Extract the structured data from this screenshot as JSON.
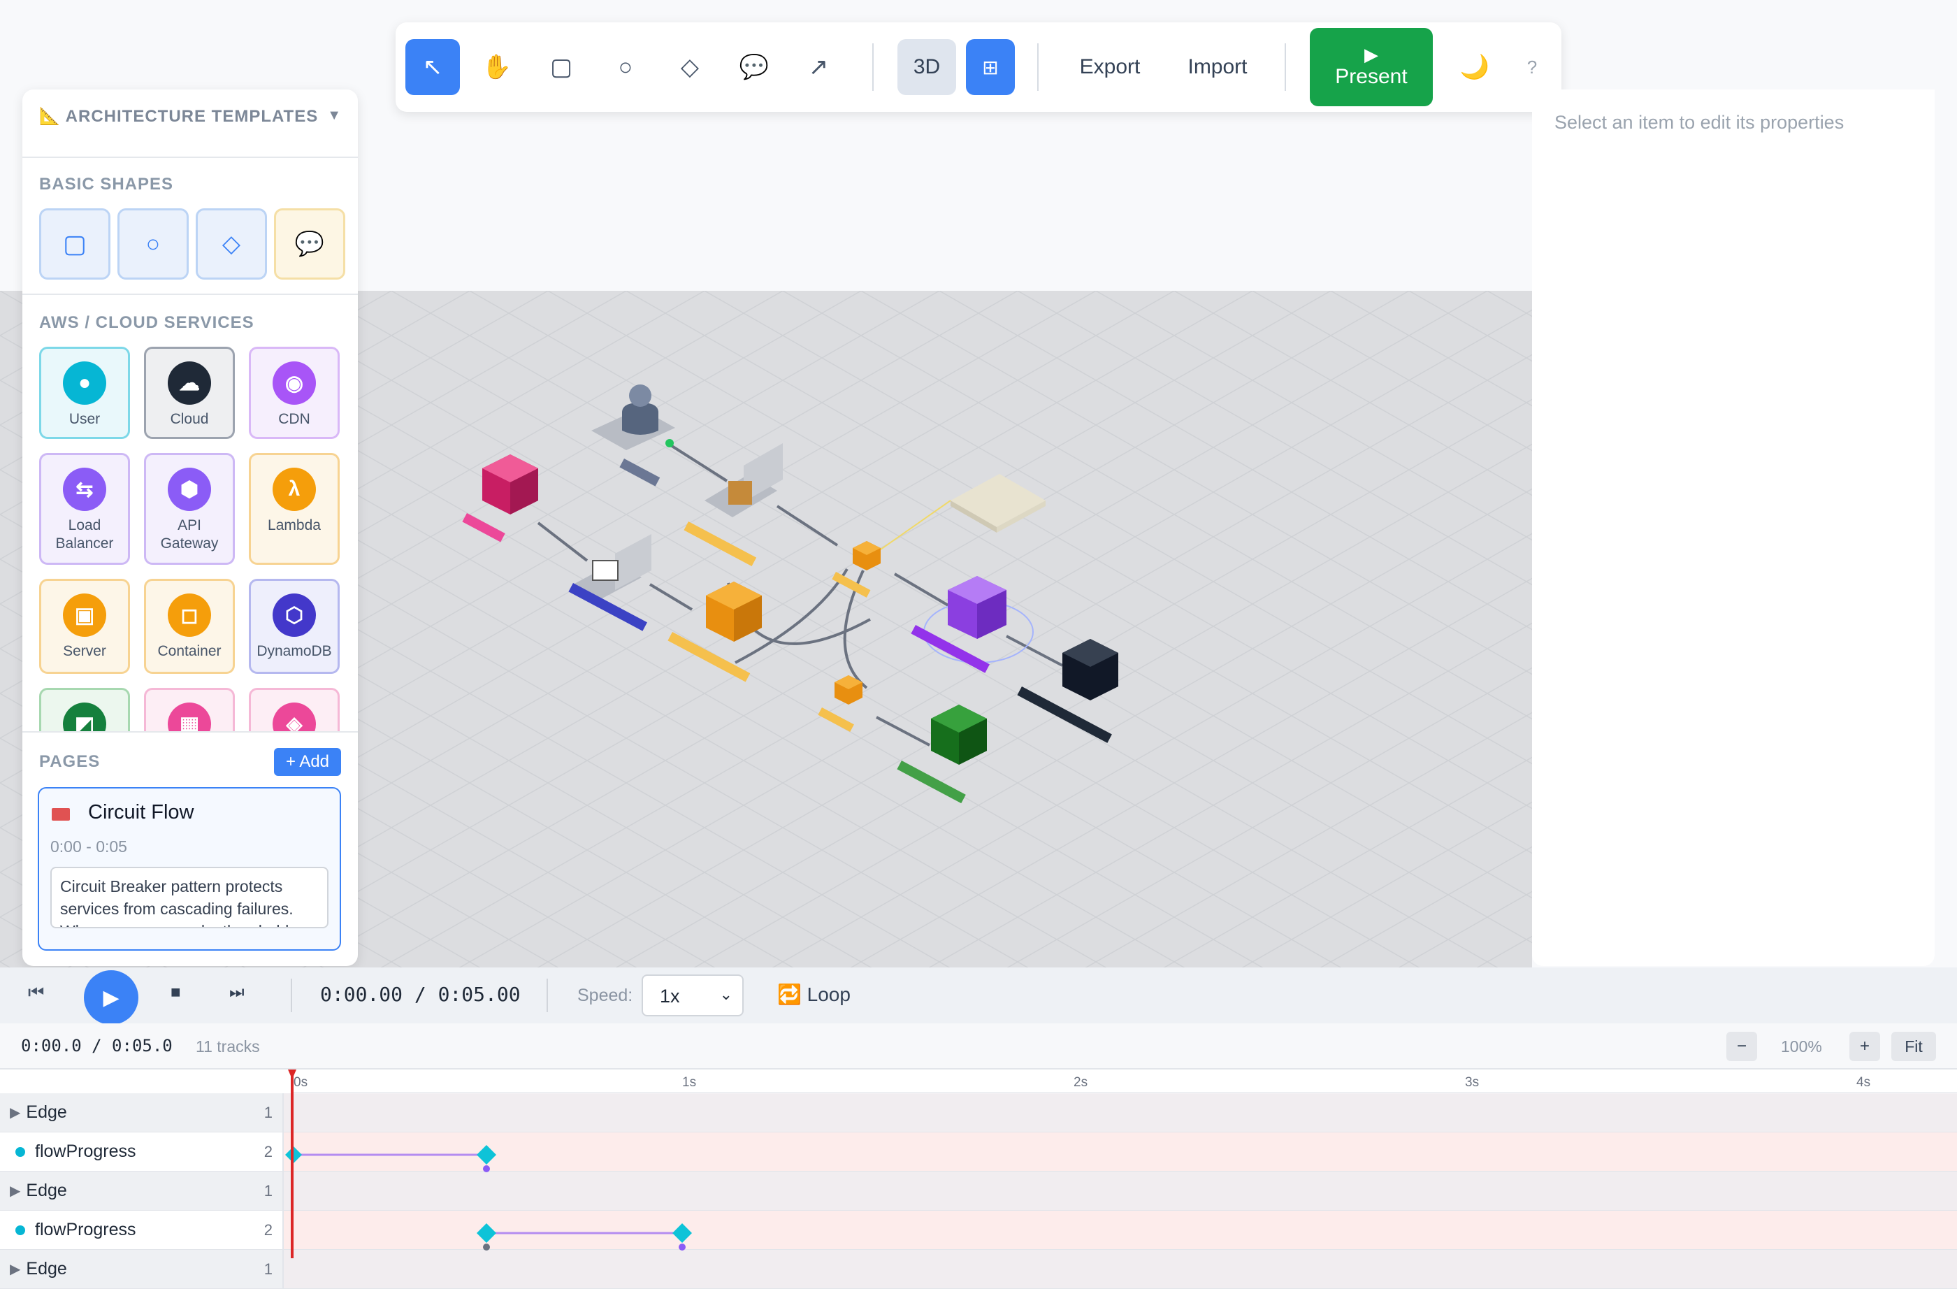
{
  "toolbar": {
    "tools": [
      "select",
      "hand",
      "rectangle",
      "circle",
      "diamond",
      "comment",
      "arrow"
    ],
    "view_3d_label": "3D",
    "export_label": "Export",
    "import_label": "Import",
    "present_label": "▶\nPresent",
    "present_color": "#16a34a",
    "accent_color": "#3b82f6",
    "help_label": "?"
  },
  "templates": {
    "title": "📐 ARCHITECTURE TEMPLATES",
    "chevron": "▼"
  },
  "basic_shapes": {
    "title": "BASIC SHAPES",
    "items": [
      {
        "icon": "square-icon",
        "glyph": "▢"
      },
      {
        "icon": "circle-icon",
        "glyph": "○"
      },
      {
        "icon": "diamond-icon",
        "glyph": "◇"
      },
      {
        "icon": "speech-bubble-icon",
        "glyph": "💬"
      }
    ]
  },
  "services": {
    "title": "AWS / CLOUD SERVICES",
    "items": [
      {
        "label": "User",
        "glyph": "●",
        "color": "#06b6d4",
        "border": "#7dd8e8",
        "bg": "#e9f8fb"
      },
      {
        "label": "Cloud",
        "glyph": "☁",
        "color": "#1f2937",
        "border": "#9ca3af",
        "bg": "#eeeff1"
      },
      {
        "label": "CDN",
        "glyph": "◉",
        "color": "#a855f7",
        "border": "#d9b8f7",
        "bg": "#f6effd"
      },
      {
        "label": "Load Balancer",
        "glyph": "⇆",
        "color": "#8b5cf6",
        "border": "#cdb8f5",
        "bg": "#f4f0fd"
      },
      {
        "label": "API Gateway",
        "glyph": "⬢",
        "color": "#8b5cf6",
        "border": "#cdb8f5",
        "bg": "#f4f0fd"
      },
      {
        "label": "Lambda",
        "glyph": "λ",
        "color": "#f59e0b",
        "border": "#f7d392",
        "bg": "#fdf6e8"
      },
      {
        "label": "Server",
        "glyph": "▣",
        "color": "#f59e0b",
        "border": "#f7d392",
        "bg": "#fdf6e8"
      },
      {
        "label": "Container",
        "glyph": "◻",
        "color": "#f59e0b",
        "border": "#f7d392",
        "bg": "#fdf6e8"
      },
      {
        "label": "DynamoDB",
        "glyph": "⬡",
        "color": "#4338ca",
        "border": "#b5b8ef",
        "bg": "#eeeffc"
      },
      {
        "label": "",
        "glyph": "◩",
        "color": "#15803d",
        "border": "#a7d8b0",
        "bg": "#ecf7ee"
      },
      {
        "label": "",
        "glyph": "▦",
        "color": "#ec4899",
        "border": "#f5b8d6",
        "bg": "#fdeef5"
      },
      {
        "label": "",
        "glyph": "◈",
        "color": "#ec4899",
        "border": "#f5b8d6",
        "bg": "#fdeef5"
      }
    ]
  },
  "pages": {
    "title": "PAGES",
    "add_label": "+ Add",
    "current": {
      "name": "Circuit Flow",
      "time_range": "0:00 - 0:05",
      "description": "Circuit Breaker pattern protects services from cascading failures. When errors exceed a threshold",
      "color": "#e05252"
    }
  },
  "properties": {
    "placeholder": "Select an item to edit its properties"
  },
  "playback": {
    "time": "0:00.00 / 0:05.00",
    "speed_label": "Speed:",
    "speed_value": "1x",
    "speed_options": [
      "1x"
    ],
    "loop_label": "🔁 Loop"
  },
  "timeline": {
    "time": "0:00.0 / 0:05.0",
    "track_count": "11 tracks",
    "zoom_minus": "−",
    "zoom": "100%",
    "zoom_plus": "+",
    "fit_label": "Fit",
    "ruler": [
      "0s",
      "1s",
      "2s",
      "3s",
      "4s"
    ],
    "tracks": [
      {
        "name": "Edge",
        "count": "1",
        "type": "group"
      },
      {
        "name": "flowProgress",
        "count": "2",
        "type": "property"
      },
      {
        "name": "Edge",
        "count": "1",
        "type": "group"
      },
      {
        "name": "flowProgress",
        "count": "2",
        "type": "property"
      },
      {
        "name": "Edge",
        "count": "1",
        "type": "group"
      }
    ]
  }
}
